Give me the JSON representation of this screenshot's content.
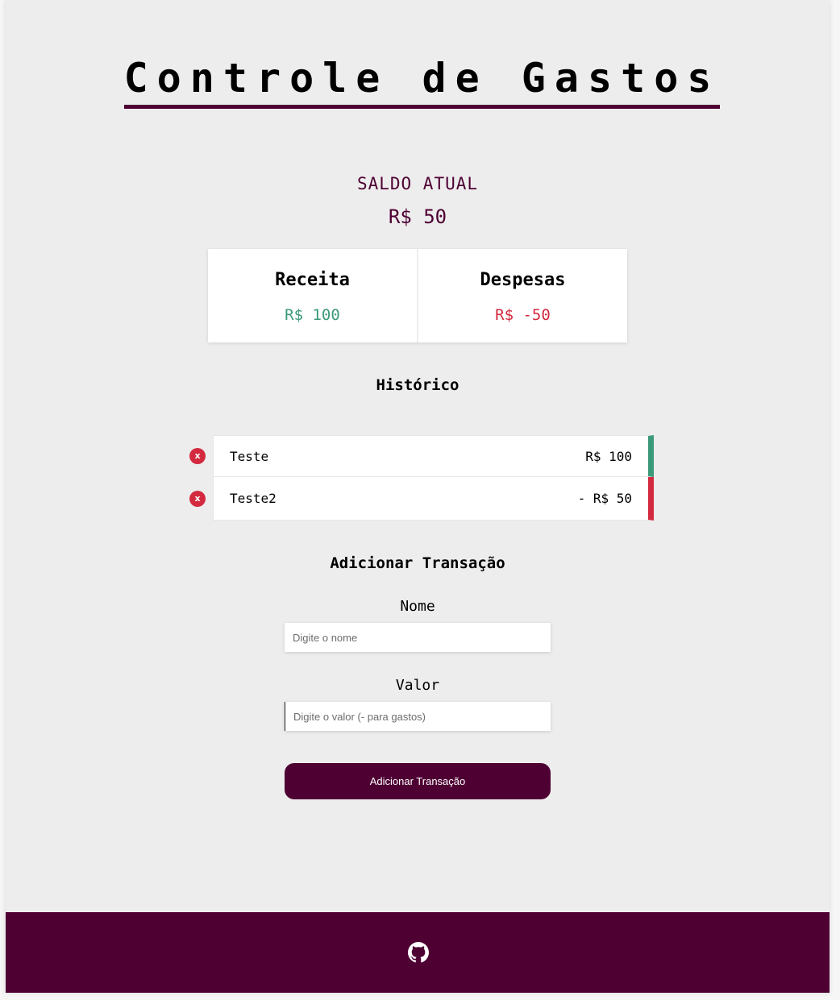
{
  "header": {
    "title": "Controle de Gastos"
  },
  "balance": {
    "label": "SALDO ATUAL",
    "value": "R$ 50"
  },
  "summary": {
    "income_label": "Receita",
    "income_value": "R$ 100",
    "expense_label": "Despesas",
    "expense_value": "R$ -50"
  },
  "history": {
    "title": "Histórico",
    "items": [
      {
        "delete_label": "x",
        "name": "Teste",
        "amount": "R$ 100",
        "type": "income"
      },
      {
        "delete_label": "x",
        "name": "Teste2",
        "amount": "- R$ 50",
        "type": "expense"
      }
    ]
  },
  "form": {
    "title": "Adicionar Transação",
    "name_label": "Nome",
    "name_placeholder": "Digite o nome",
    "value_label": "Valor",
    "value_placeholder": "Digite o valor (- para gastos)",
    "submit_label": "Adicionar Transação"
  },
  "footer": {
    "icon": "github-icon"
  },
  "colors": {
    "brand": "#4e0033",
    "income": "#3b9a7a",
    "expense": "#d32a3f",
    "background": "#ededed"
  }
}
